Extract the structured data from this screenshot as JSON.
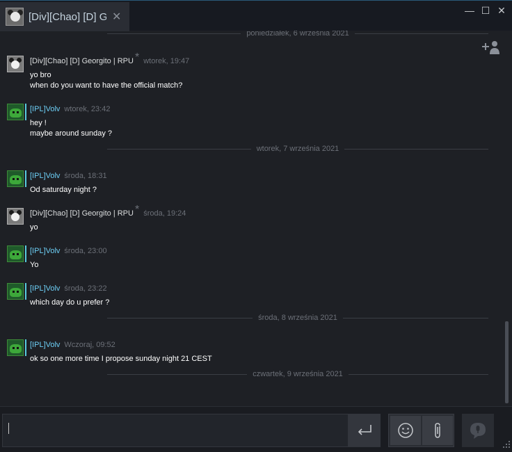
{
  "window": {
    "tab_title": "[Div][Chao] [D] G",
    "tab_close": "✕",
    "minimize": "—",
    "maximize": "☐",
    "close": "✕"
  },
  "dividers": [
    "poniedziałek, 6 września 2021",
    "wtorek, 7 września 2021",
    "środa, 8 września 2021",
    "czwartek, 9 września 2021"
  ],
  "messages": [
    {
      "author": "[Div][Chao] [D] Georgito | RPU",
      "star": "*",
      "time": "wtorek, 19:47",
      "lines": [
        "yo bro",
        "when do you want to have the official match?"
      ]
    },
    {
      "author": "[IPL]Volv",
      "time": "wtorek, 23:42",
      "lines": [
        "hey !",
        "maybe around sunday ?"
      ]
    },
    {
      "author": "[IPL]Volv",
      "time": "środa, 18:31",
      "lines": [
        "Od saturday night ?"
      ]
    },
    {
      "author": "[Div][Chao] [D] Georgito | RPU",
      "star": "*",
      "time": "środa, 19:24",
      "lines": [
        "yo"
      ]
    },
    {
      "author": "[IPL]Volv",
      "time": "środa, 23:00",
      "lines": [
        "Yo"
      ]
    },
    {
      "author": "[IPL]Volv",
      "time": "środa, 23:22",
      "lines": [
        "which day do u prefer ?"
      ]
    },
    {
      "author": "[IPL]Volv",
      "time": "Wczoraj, 09:52",
      "lines": [
        "ok so one more time I propose sunday night 21 CEST"
      ]
    }
  ],
  "colors": {
    "accent_blue": "#6dcff6",
    "online_bar": "#57cbde",
    "background": "#1e2025"
  },
  "icons": {
    "add_friend": "add-friend-icon",
    "send": "send-enter-icon",
    "emoji": "smiley-icon",
    "attach": "paperclip-icon",
    "voice": "voice-chat-icon"
  }
}
